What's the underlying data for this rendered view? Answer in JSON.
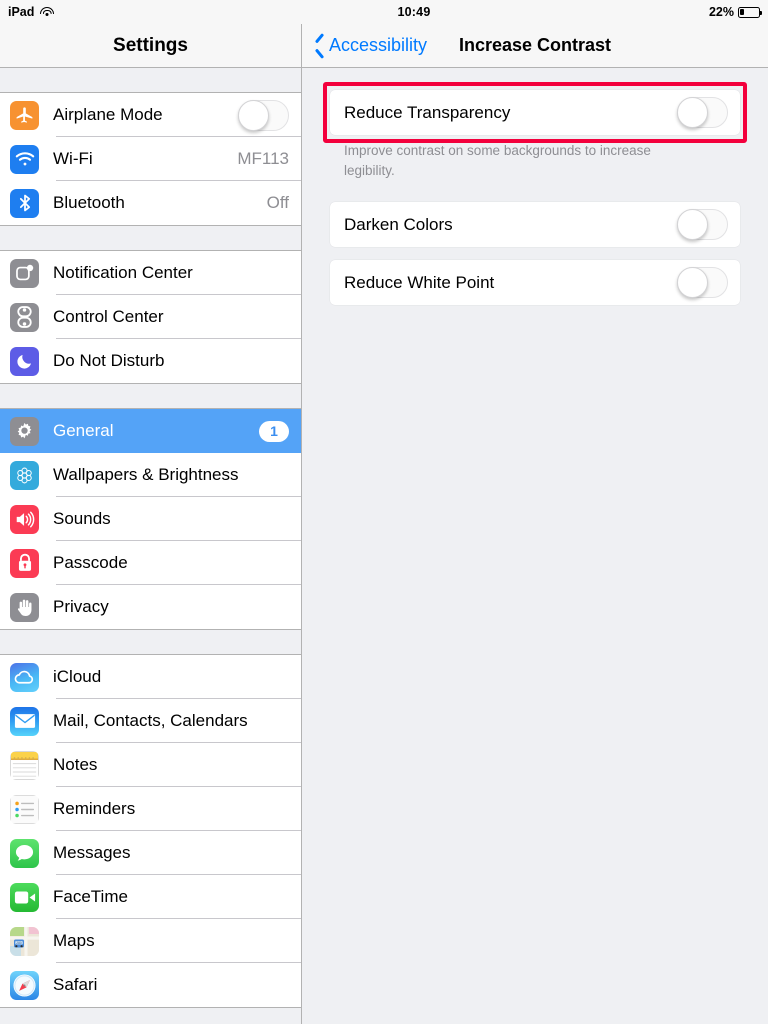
{
  "status_bar": {
    "device": "iPad",
    "wifi_icon": "wifi-icon",
    "time": "10:49",
    "battery_percent": "22%",
    "battery_level": 22
  },
  "nav": {
    "sidebar_title": "Settings",
    "back_icon": "chevron-left-icon",
    "back_label": "Accessibility",
    "detail_title": "Increase Contrast"
  },
  "colors": {
    "accent_blue": "#007aff",
    "selected_row": "#54a3f7",
    "annotation_red": "#f3003c",
    "panel_background": "#eff0f3",
    "secondary_text": "#8e8e93"
  },
  "sidebar": {
    "groups": [
      {
        "items": [
          {
            "label": "Airplane Mode",
            "icon": "airplane-icon",
            "icon_color": "#f79231",
            "accessory": "toggle",
            "toggle_on": false
          },
          {
            "label": "Wi-Fi",
            "icon": "wifi-icon",
            "icon_color": "#1e7ef0",
            "accessory": "value",
            "value": "MF113"
          },
          {
            "label": "Bluetooth",
            "icon": "bluetooth-icon",
            "icon_color": "#1e7ef0",
            "accessory": "value",
            "value": "Off"
          }
        ]
      },
      {
        "items": [
          {
            "label": "Notification Center",
            "icon": "notification-center-icon",
            "icon_color": "#8e8e93",
            "accessory": "none"
          },
          {
            "label": "Control Center",
            "icon": "control-center-icon",
            "icon_color": "#8e8e93",
            "accessory": "none"
          },
          {
            "label": "Do Not Disturb",
            "icon": "moon-icon",
            "icon_color": "#5d5ce6",
            "accessory": "none"
          }
        ]
      },
      {
        "items": [
          {
            "label": "General",
            "icon": "gear-icon",
            "icon_color": "#8e8e93",
            "accessory": "badge",
            "badge": "1",
            "selected": true
          },
          {
            "label": "Wallpapers & Brightness",
            "icon": "wallpaper-icon",
            "icon_color": "#34aadc",
            "accessory": "none"
          },
          {
            "label": "Sounds",
            "icon": "speaker-icon",
            "icon_color": "#fb3b54",
            "accessory": "none"
          },
          {
            "label": "Passcode",
            "icon": "lock-icon",
            "icon_color": "#fb3b54",
            "accessory": "none"
          },
          {
            "label": "Privacy",
            "icon": "hand-icon",
            "icon_color": "#8e8e93",
            "accessory": "none"
          }
        ]
      },
      {
        "items": [
          {
            "label": "iCloud",
            "icon": "icloud-icon",
            "icon_color": "#3aa5f0",
            "accessory": "none"
          },
          {
            "label": "Mail, Contacts, Calendars",
            "icon": "mail-icon",
            "icon_color": "#2a9bf2",
            "accessory": "none"
          },
          {
            "label": "Notes",
            "icon": "notes-icon",
            "icon_color": "#fbd24a",
            "accessory": "none"
          },
          {
            "label": "Reminders",
            "icon": "reminders-icon",
            "icon_color": "#f4f4f4",
            "accessory": "none"
          },
          {
            "label": "Messages",
            "icon": "messages-icon",
            "icon_color": "#4cd964",
            "accessory": "none"
          },
          {
            "label": "FaceTime",
            "icon": "facetime-icon",
            "icon_color": "#36cc44",
            "accessory": "none"
          },
          {
            "label": "Maps",
            "icon": "maps-icon",
            "icon_color": "#e8e2d2",
            "accessory": "none"
          },
          {
            "label": "Safari",
            "icon": "safari-icon",
            "icon_color": "#3ab0f5",
            "accessory": "none"
          }
        ]
      }
    ]
  },
  "detail": {
    "rows": [
      {
        "label": "Reduce Transparency",
        "toggle_on": false,
        "highlighted": true,
        "footnote": "Improve contrast on some backgrounds to increase legibility."
      },
      {
        "label": "Darken Colors",
        "toggle_on": false,
        "highlighted": false,
        "footnote": ""
      },
      {
        "label": "Reduce White Point",
        "toggle_on": false,
        "highlighted": false,
        "footnote": ""
      }
    ]
  }
}
